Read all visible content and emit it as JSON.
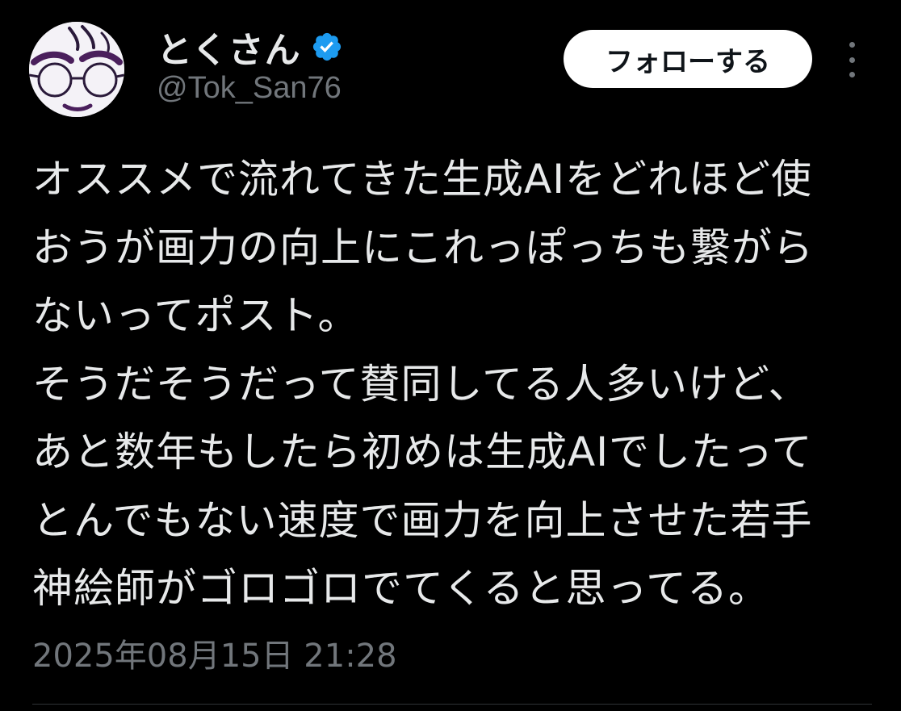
{
  "colors": {
    "background": "#000000",
    "text_primary": "#e7e9ea",
    "text_secondary": "#71767b",
    "verified_badge": "#1d9bf0",
    "follow_button_bg": "#ffffff",
    "follow_button_text": "#0f1419",
    "divider": "#2f3336"
  },
  "author": {
    "display_name": "とくさん",
    "handle": "@Tok_San76",
    "verified": true,
    "verified_icon": "verified-badge-icon",
    "avatar_icon": "avatar-face-with-glasses"
  },
  "actions": {
    "follow_label": "フォローする",
    "more_icon": "vertical-ellipsis-icon"
  },
  "post": {
    "lines": [
      "オススメで流れてきた生成AIをどれほど使",
      "おうが画力の向上にこれっぽっちも繋がら",
      "ないってポスト。",
      "そうだそうだって賛同してる人多いけど、",
      "あと数年もしたら初めは生成AIでしたって",
      "とんでもない速度で画力を向上させた若手",
      "神絵師がゴロゴロでてくると思ってる。"
    ],
    "timestamp": "2025年08月15日 21:28"
  }
}
